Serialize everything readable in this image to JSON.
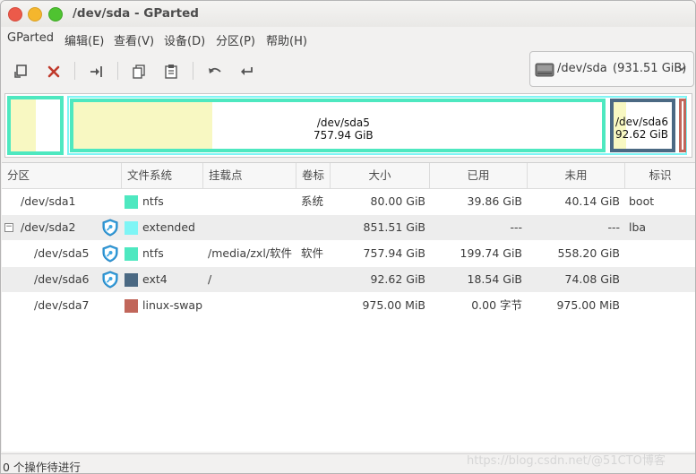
{
  "window": {
    "title": "/dev/sda - GParted"
  },
  "menu": [
    "GParted",
    "编辑(E)",
    "查看(V)",
    "设备(D)",
    "分区(P)",
    "帮助(H)"
  ],
  "toolbar": {
    "icons": [
      "new-partition-icon",
      "delete-icon",
      "resize-move-icon",
      "copy-icon",
      "paste-icon",
      "undo-icon",
      "apply-icon"
    ]
  },
  "device": {
    "name": "/dev/sda",
    "size": "(931.51 GiB)"
  },
  "diskmap": {
    "sda5": {
      "name": "/dev/sda5",
      "size": "757.94 GiB"
    },
    "sda6": {
      "name": "/dev/sda6",
      "size": "92.62 GiB"
    },
    "colors": {
      "ntfs": "#4ee8c0",
      "ext4": "#4b6983",
      "swap": "#c1665a",
      "used": "#f8f8c2",
      "extended": "#7ef5f5"
    }
  },
  "table": {
    "headers": [
      "分区",
      "文件系统",
      "挂载点",
      "卷标",
      "大小",
      "已用",
      "未用",
      "标识"
    ],
    "rows": [
      {
        "partition": "/dev/sda1",
        "fs": "ntfs",
        "fs_color": "#4ee8c0",
        "mount": "",
        "label": "系统",
        "size": "80.00 GiB",
        "used": "39.86 GiB",
        "unused": "40.14 GiB",
        "flags": "boot",
        "lock": false
      },
      {
        "partition": "/dev/sda2",
        "fs": "extended",
        "fs_color": "#7ef5f5",
        "mount": "",
        "label": "",
        "size": "851.51 GiB",
        "used": "---",
        "unused": "---",
        "flags": "lba",
        "lock": true
      },
      {
        "partition": "/dev/sda5",
        "fs": "ntfs",
        "fs_color": "#4ee8c0",
        "mount": "/media/zxl/软件",
        "label": "软件",
        "size": "757.94 GiB",
        "used": "199.74 GiB",
        "unused": "558.20 GiB",
        "flags": "",
        "lock": true
      },
      {
        "partition": "/dev/sda6",
        "fs": "ext4",
        "fs_color": "#4b6983",
        "mount": "/",
        "label": "",
        "size": "92.62 GiB",
        "used": "18.54 GiB",
        "unused": "74.08 GiB",
        "flags": "",
        "lock": true
      },
      {
        "partition": "/dev/sda7",
        "fs": "linux-swap",
        "fs_color": "#c1665a",
        "mount": "",
        "label": "",
        "size": "975.00 MiB",
        "used": "0.00 字节",
        "unused": "975.00 MiB",
        "flags": "",
        "lock": false
      }
    ]
  },
  "status": "0 个操作待进行",
  "watermark": "https://blog.csdn.net/@51CTO博客"
}
